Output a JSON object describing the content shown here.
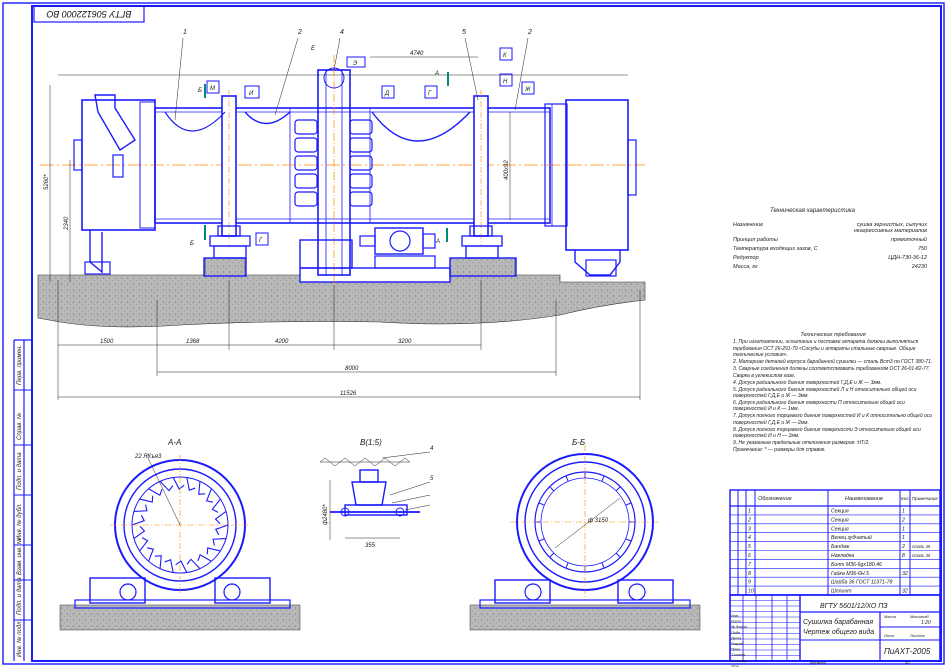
{
  "drawing": {
    "code_stamp": "ВГТУ 506122000 ВО",
    "doc_code": "ВГТУ 5601/12/ХО ПЗ",
    "title_line1": "Сушилка барабанная",
    "title_line2": "Чертеж общего вида",
    "org": "ПиАХТ-2005",
    "sheet_label": "Лист",
    "sheets_label": "Листов",
    "mass_label": "Масса",
    "scale_label": "Масштаб",
    "scale_value": "1:20",
    "format_label": "Формат",
    "format_value": "А1"
  },
  "sections": {
    "aa": "А-А",
    "bb": "Б-Б",
    "detail": "В(1:5)"
  },
  "positions": [
    "1",
    "2",
    "3",
    "4",
    "5",
    "2"
  ],
  "markers": [
    "Б",
    "М",
    "И",
    "Е",
    "Э",
    "Д",
    "Г",
    "А",
    "Ж",
    "К",
    "Н",
    "Б",
    "Г",
    "А"
  ],
  "dimensions": {
    "d1": "1500",
    "d2": "1368",
    "d3": "4200",
    "d4": "3200",
    "d5": "8000",
    "d6": "11526",
    "v1": "5260*",
    "v2": "2340",
    "v3": "400x92",
    "top": "4740",
    "aa_dim": "22 ЯКъя3",
    "bb_dim": "ф 3150",
    "detail_v": "ф2480*",
    "detail_h": "355"
  },
  "characteristics": {
    "title": "Техническая характеристика",
    "rows": [
      {
        "label": "Назначение",
        "value": "сушка зернистых, сыпучих неагрессивных материалов"
      },
      {
        "label": "Принцип работы",
        "value": "прямоточный"
      },
      {
        "label": "Температура входящих газов, С",
        "value": "750"
      },
      {
        "label": "Редуктор",
        "value": "ЦДН-730-36-12"
      },
      {
        "label": "Масса, кг",
        "value": "24230"
      }
    ]
  },
  "requirements": {
    "title": "Технические требования",
    "items": [
      "1. При изготовлении, испытании и поставке аппарата должны выполняться требования ОСТ 26-291-79 «Сосуды и аппараты стальные сварные. Общие технические условия».",
      "2. Материал деталей корпуса барабанной сушилки — сталь Вст3 по ГОСТ 380-71.",
      "3. Сварные соединения должны соответствовать требованиям ОСТ 26-01-82-77. Сварка в углекислом газе.",
      "4. Допуск радиального биения поверхностей Г,Д,Е и Ж — 3мм.",
      "5. Допуск радиального биения поверхностей Л и Н относительно общей оси поверхностей Г,Д,Е и Ж — 3мм.",
      "6. Допуск радиального биения поверхности П относительно общей оси поверхностей И и К — 1мм.",
      "7. Допуск полного торцевого биения поверхностей И и К относительно общей оси поверхностей Г,Д,Е и Ж — 2мм.",
      "8. Допуск полного торцевого биения поверхности Э относительно общей оси поверхностей И и Н — 2мм.",
      "9. Не указанные предельные отклонения размеров: ±IT/2.",
      "Примечание: * — размеры для справок."
    ]
  },
  "spec_table": {
    "headers": [
      "Формат",
      "Зона",
      "Поз.",
      "Обозначение",
      "Наименование",
      "Кол.",
      "Примечание"
    ],
    "rows": [
      {
        "pos": "1",
        "name": "Секция",
        "qty": "1",
        "note": ""
      },
      {
        "pos": "2",
        "name": "Секция",
        "qty": "2",
        "note": ""
      },
      {
        "pos": "3",
        "name": "Секция",
        "qty": "1",
        "note": ""
      },
      {
        "pos": "4",
        "name": "Венец зубчатый",
        "qty": "1",
        "note": ""
      },
      {
        "pos": "5",
        "name": "Бандаж",
        "qty": "2",
        "note": "сталь 45"
      },
      {
        "pos": "6",
        "name": "Накладка",
        "qty": "8",
        "note": "сталь 35"
      },
      {
        "pos": "7",
        "name": "Болт М36-6gx180.46",
        "qty": "",
        "note": ""
      },
      {
        "pos": "8",
        "name": "Гайка М36-6Н.5",
        "qty": "32",
        "note": ""
      },
      {
        "pos": "9",
        "name": "Шайба 36 ГОСТ 11371-78",
        "qty": "",
        "note": ""
      },
      {
        "pos": "10",
        "name": "Шплинт",
        "qty": "32",
        "note": ""
      }
    ]
  },
  "side_stamps": [
    "Перв. примен.",
    "Справ. №",
    "Подп. и дата",
    "Инв. № дубл.",
    "Взам. инв. №",
    "Подп. и дата",
    "Инв. № подл."
  ],
  "signatures": [
    "Изм.",
    "Лист",
    "№ докум.",
    "Подп.",
    "Дата",
    "Разраб.",
    "Пров.",
    "Т.контр.",
    "Н.контр.",
    "Утв."
  ]
}
